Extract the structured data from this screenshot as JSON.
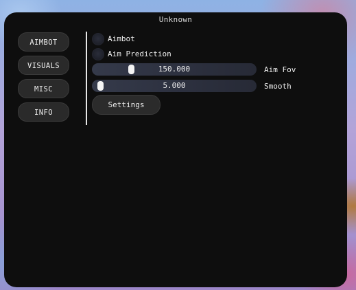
{
  "window": {
    "title": "Unknown"
  },
  "nav": {
    "items": [
      {
        "label": "AIMBOT"
      },
      {
        "label": "VISUALS"
      },
      {
        "label": "MISC"
      },
      {
        "label": "INFO"
      }
    ]
  },
  "aimbot": {
    "toggles": [
      {
        "label": "Aimbot",
        "enabled": false
      },
      {
        "label": "Aim Prediction",
        "enabled": false
      }
    ],
    "sliders": [
      {
        "label": "Aim Fov",
        "value_text": "150.000",
        "position_fraction": 0.24
      },
      {
        "label": "Smooth",
        "value_text": "5.000",
        "position_fraction": 0.05
      }
    ],
    "settings_label": "Settings"
  },
  "colors": {
    "panel_background": "#0e0e0e",
    "button_background": "#2a2a2a",
    "slider_track": "#2d3140",
    "text": "#efefef"
  }
}
